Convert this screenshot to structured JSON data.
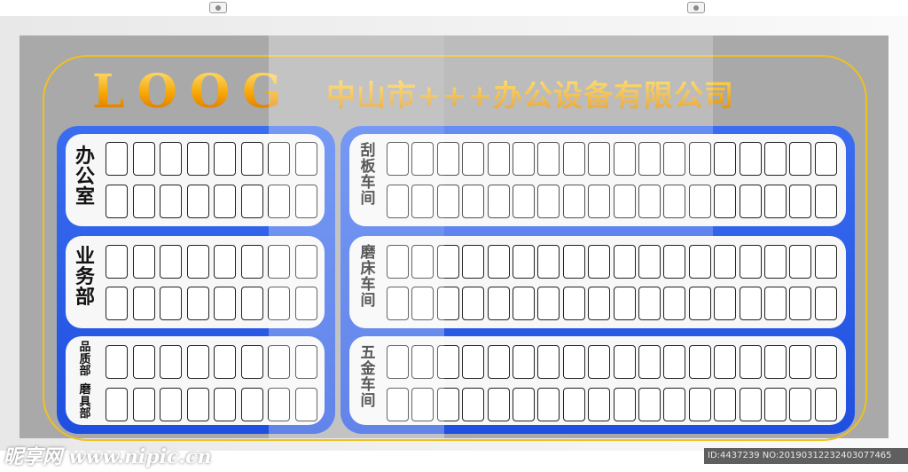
{
  "header": {
    "logo": "LOOG",
    "company": "中山市+++办公设备有限公司"
  },
  "left_panel": {
    "rows": [
      {
        "label": "办公室"
      },
      {
        "label": "业务部"
      },
      {
        "label_top": "品质部",
        "label_bottom": "磨具部"
      }
    ]
  },
  "right_panel": {
    "rows": [
      {
        "label": "刮板车间"
      },
      {
        "label": "磨床车间"
      },
      {
        "label": "五金车间"
      }
    ]
  },
  "footer": {
    "watermark": "昵享网 www.nipic.cn",
    "image_id": "ID:4437239 NO:20190312232403077465"
  },
  "colors": {
    "panel_blue": "#2a5ce8",
    "gold": "#f0c020",
    "board_gray": "#a9a9a9"
  }
}
